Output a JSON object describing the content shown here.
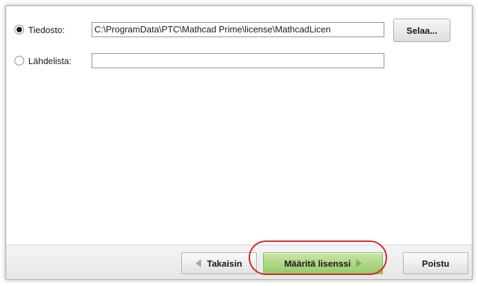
{
  "license_source": {
    "file_option": {
      "label": "Tiedosto:",
      "checked": true
    },
    "file_path": "C:\\ProgramData\\PTC\\Mathcad Prime\\license\\MathcadLicen",
    "source_list_option": {
      "label": "Lähdelista:",
      "checked": false
    },
    "source_list_value": "",
    "browse_label": "Selaa..."
  },
  "footer": {
    "back_label": "Takaisin",
    "apply_label": "Määritä lisenssi",
    "remove_label": "Poistu"
  },
  "colors": {
    "apply_button_top": "#c9e7a5",
    "apply_button_bottom": "#97c96a",
    "highlight_ring": "#d62020"
  },
  "icons": {
    "back": "triangle-left",
    "apply": "triangle-right"
  }
}
